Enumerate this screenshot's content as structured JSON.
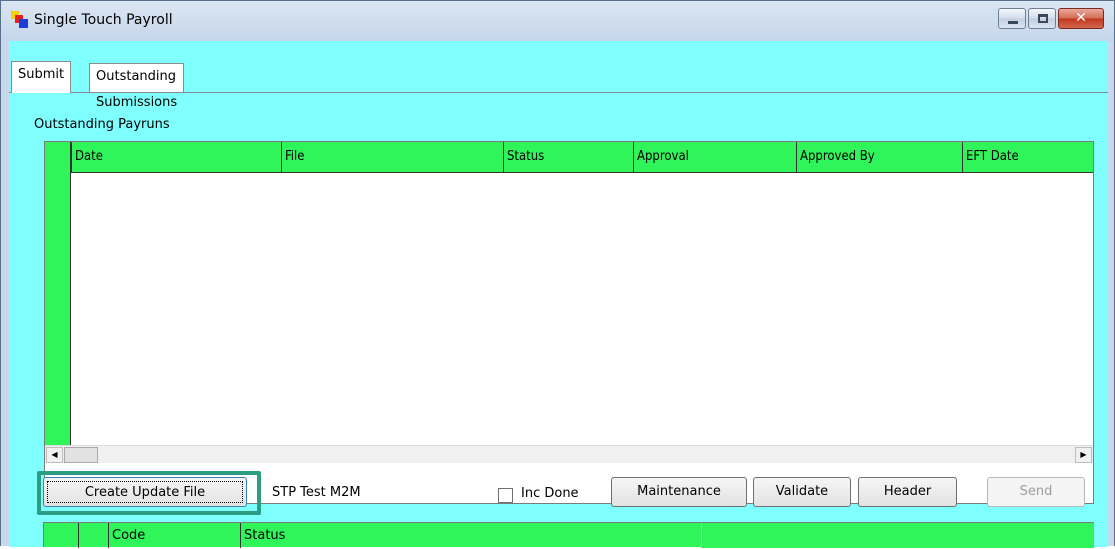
{
  "window": {
    "title": "Single Touch Payroll",
    "controls": [
      "minimize-icon",
      "maximize-icon",
      "close-icon"
    ],
    "close_glyph": "✕"
  },
  "tabs": [
    {
      "label": "Submit",
      "active": true
    },
    {
      "label": "Outstanding Submissions",
      "active": false
    }
  ],
  "payruns": {
    "label": "Outstanding Payruns",
    "columns": [
      "Date",
      "File",
      "Status",
      "Approval",
      "Approved By",
      "EFT Date"
    ],
    "rows": []
  },
  "scroll": {
    "left_glyph": "◀",
    "right_glyph": "▶"
  },
  "toolbar": {
    "create_update_file": "Create Update File",
    "profile_text": "STP Test M2M",
    "inc_done_label": "Inc Done",
    "inc_done_checked": false,
    "maintenance": "Maintenance",
    "validate": "Validate",
    "header": "Header",
    "send": "Send",
    "send_enabled": false
  },
  "submissions": {
    "columns": [
      "Code",
      "Status"
    ]
  },
  "colors": {
    "client_bg": "#80ffff",
    "grid_header": "#2ff55a",
    "highlight": "#2a9d82"
  }
}
